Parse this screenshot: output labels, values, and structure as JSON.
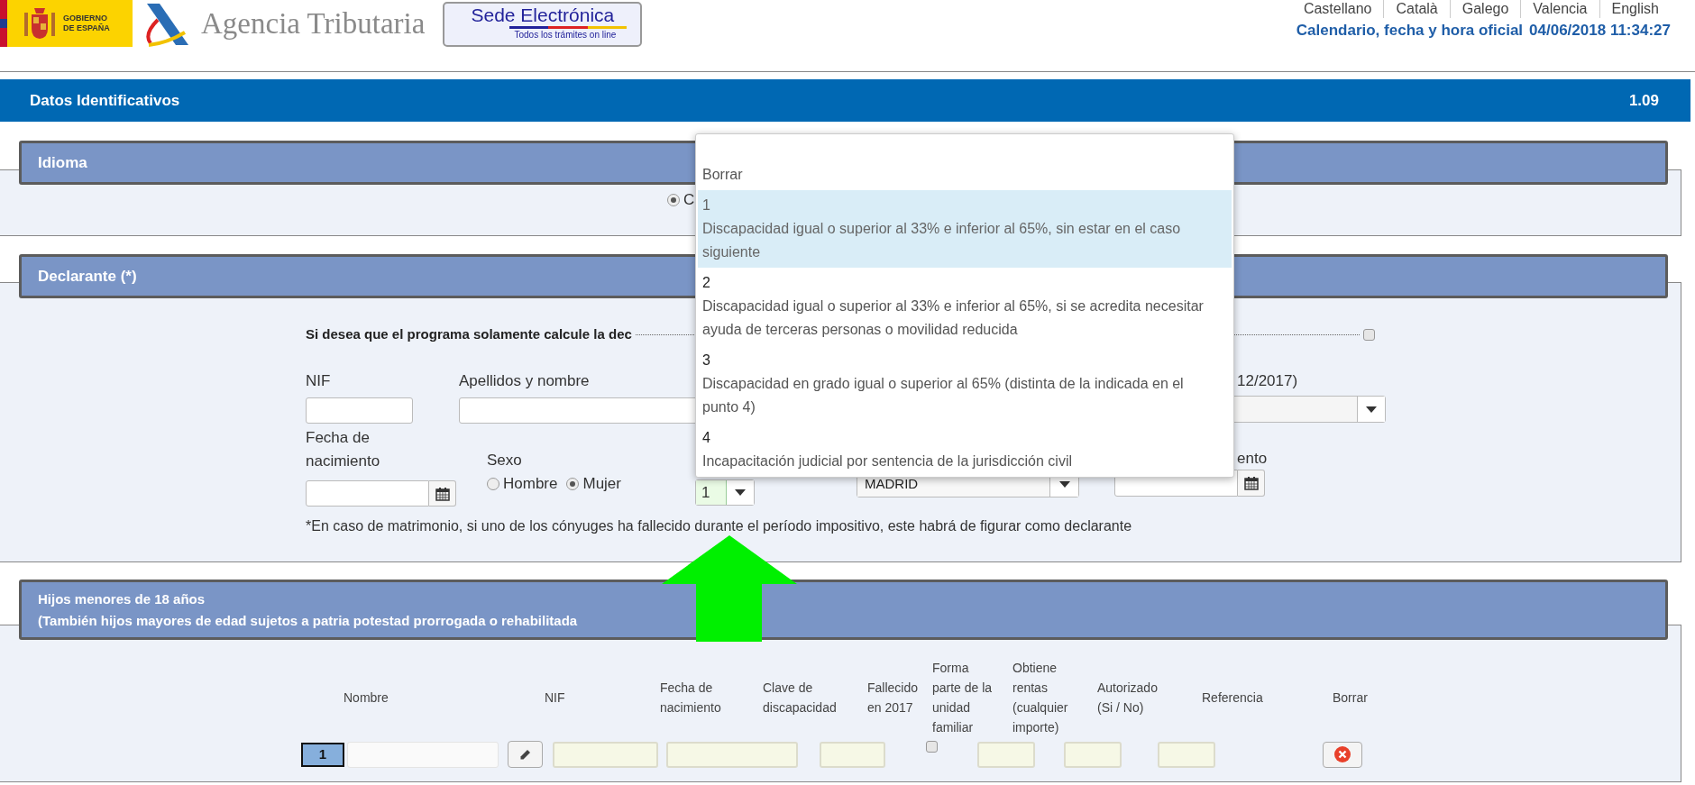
{
  "header": {
    "government_logo_lines": [
      "GOBIERNO",
      "DE ESPAÑA"
    ],
    "agency_name": "Agencia Tributaria",
    "sede_title": "Sede Electrónica",
    "sede_subtitle": "Todos los trámites on line",
    "languages": [
      "Castellano",
      "Català",
      "Galego",
      "Valencia",
      "English"
    ],
    "clock_label": "Calendario, fecha y hora oficial",
    "clock_value": "04/06/2018 11:34:27"
  },
  "title_bar": {
    "title": "Datos Identificativos",
    "version": "1.09"
  },
  "idioma": {
    "title": "Idioma",
    "options": [
      {
        "label": "C",
        "selected": true
      }
    ]
  },
  "declarante": {
    "title": "Declarante (*)",
    "calc_prompt": "Si desea que el programa solamente calcule la dec",
    "calc_checked": false,
    "nif_label": "NIF",
    "name_label": "Apellidos y nombre",
    "status_label": "12/2017)",
    "birth_label": "Fecha de nacimiento",
    "sex_label": "Sexo",
    "sex_options": [
      {
        "label": "Hombre",
        "selected": false
      },
      {
        "label": "Mujer",
        "selected": true
      }
    ],
    "disability_value": "1",
    "province_value": "MADRID",
    "date_label": "ento",
    "note": "*En caso de matrimonio, si uno de los cónyuges ha fallecido durante el período impositivo, este habrá de figurar como declarante"
  },
  "disability_dropdown": {
    "options": [
      {
        "kind": "plain",
        "label": "Borrar",
        "selected": false
      },
      {
        "kind": "coded",
        "code": "1",
        "description": "Discapacidad igual o superior al 33% e inferior al 65%, sin estar en el caso siguiente",
        "selected": true
      },
      {
        "kind": "coded",
        "code": "2",
        "description": "Discapacidad igual o superior al 33% e inferior al 65%, si se acredita necesitar ayuda de terceras personas o movilidad reducida",
        "selected": false
      },
      {
        "kind": "coded",
        "code": "3",
        "description": "Discapacidad en grado igual o superior al 65% (distinta de la indicada en el punto 4)",
        "selected": false
      },
      {
        "kind": "coded",
        "code": "4",
        "description": "Incapacitación judicial por sentencia de la jurisdicción civil",
        "selected": false
      }
    ]
  },
  "hijos": {
    "title_lines": [
      "Hijos menores de 18 años",
      "(También hijos mayores de edad sujetos a patria potestad prorrogada o rehabilitada"
    ],
    "columns": [
      "Nombre",
      "NIF",
      "Fecha de nacimiento",
      "Clave de discapacidad",
      "Fallecido en 2017",
      "Forma parte de la unidad familiar",
      "Obtiene rentas (cualquier importe)",
      "Autorizado (Si / No)",
      "Referencia",
      "Borrar"
    ],
    "rows": [
      {
        "index": "1",
        "deceased": false
      }
    ]
  }
}
